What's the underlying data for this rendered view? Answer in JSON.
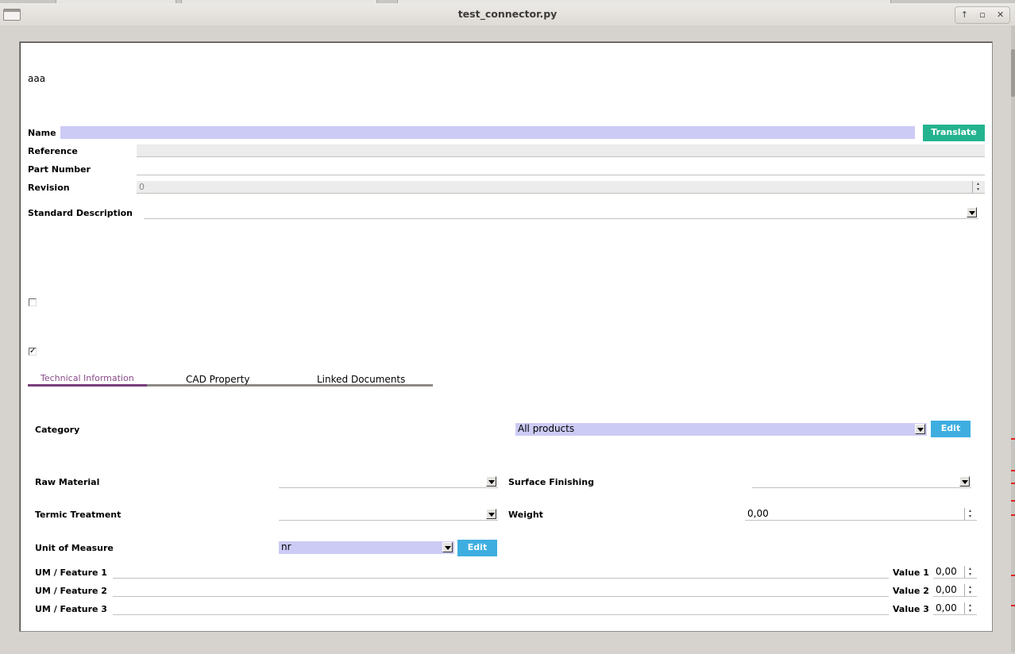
{
  "window": {
    "title": "test_connector.py"
  },
  "form": {
    "header_text": "aaa",
    "name": {
      "label": "Name",
      "value": "",
      "translate_label": "Translate"
    },
    "reference": {
      "label": "Reference",
      "value": ""
    },
    "part_number": {
      "label": "Part Number",
      "value": ""
    },
    "revision": {
      "label": "Revision",
      "value": "0"
    },
    "standard_description": {
      "label": "Standard Description",
      "value": ""
    },
    "checkbox_1_checked": false,
    "checkbox_2_checked": true
  },
  "tabs": [
    {
      "label": "Technical Information",
      "active": true
    },
    {
      "label": "CAD Property",
      "active": false
    },
    {
      "label": "Linked Documents",
      "active": false
    }
  ],
  "technical": {
    "category": {
      "label": "Category",
      "value": "All products",
      "edit_label": "Edit"
    },
    "raw_material": {
      "label": "Raw Material",
      "value": ""
    },
    "surface_finishing": {
      "label": "Surface Finishing",
      "value": ""
    },
    "termic_treatment": {
      "label": "Termic Treatment",
      "value": ""
    },
    "weight": {
      "label": "Weight",
      "value": "0,00"
    },
    "unit_of_measure": {
      "label": "Unit of Measure",
      "value": "nr",
      "edit_label": "Edit"
    },
    "features": [
      {
        "label": "UM / Feature 1",
        "value": "",
        "value_label": "Value 1",
        "number": "0,00"
      },
      {
        "label": "UM / Feature 2",
        "value": "",
        "value_label": "Value 2",
        "number": "0,00"
      },
      {
        "label": "UM / Feature 3",
        "value": "",
        "value_label": "Value 3",
        "number": "0,00"
      }
    ]
  },
  "colors": {
    "translate_button": "#24b38f",
    "edit_button": "#3eaee0",
    "active_tab_text": "#8a4a8a",
    "active_tab_underline": "#7a3d7a",
    "field_focus_blue": "#cccbf5"
  }
}
